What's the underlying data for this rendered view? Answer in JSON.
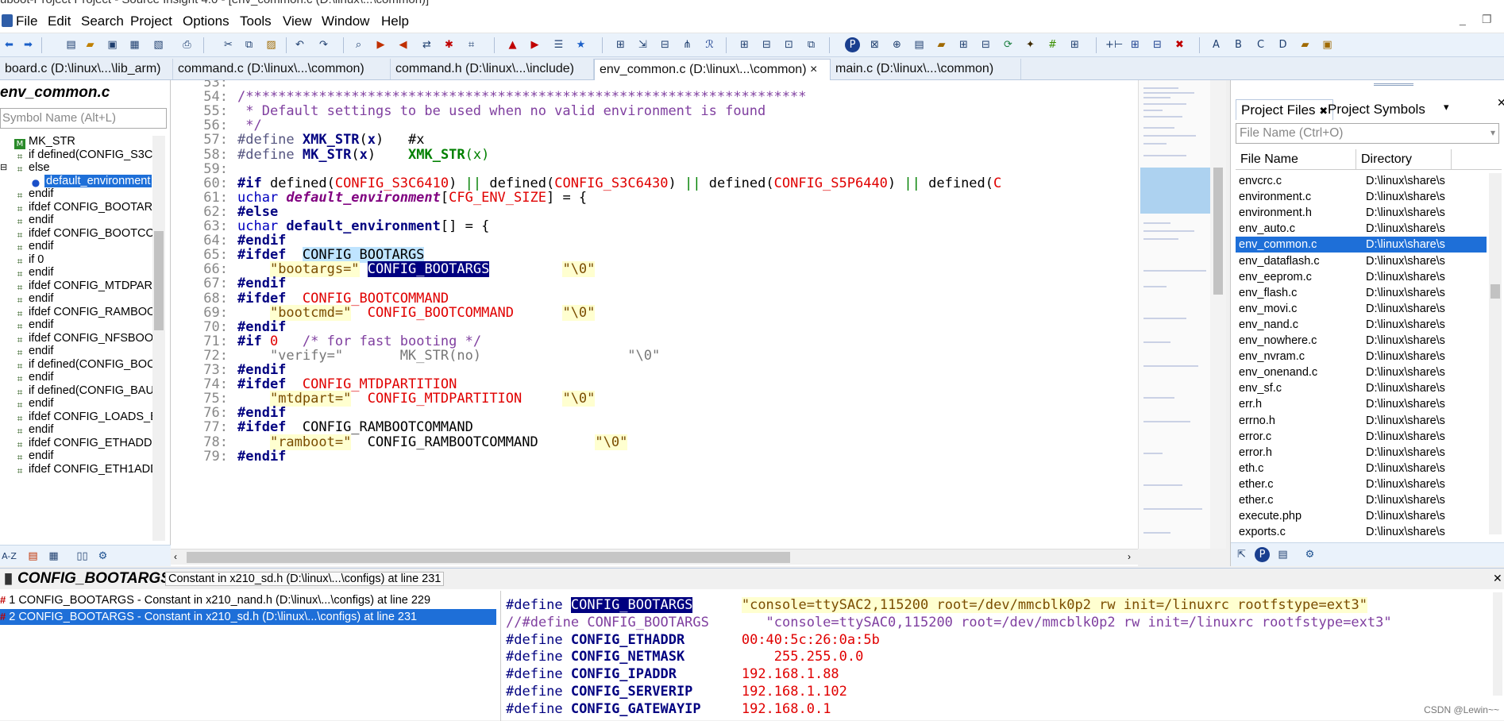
{
  "window": {
    "title": "uboot-Project Project - Source Insight 4.0 - [env_common.c (D:\\linux\\...\\common)]"
  },
  "menu": [
    "File",
    "Edit",
    "Search",
    "Project",
    "Options",
    "Tools",
    "View",
    "Window",
    "Help"
  ],
  "tabs": [
    {
      "label": "board.c (D:\\linux\\...\\lib_arm)"
    },
    {
      "label": "command.c (D:\\linux\\...\\common)"
    },
    {
      "label": "command.h (D:\\linux\\...\\include)"
    },
    {
      "label": "env_common.c (D:\\linux\\...\\common)",
      "close": "×"
    },
    {
      "label": "main.c (D:\\linux\\...\\common)"
    }
  ],
  "symbol_window": {
    "title": "env_common.c",
    "search_placeholder": "Symbol Name (Alt+L)",
    "items": [
      {
        "label": "MK_STR",
        "icon": "macro-icon"
      },
      {
        "label": "if defined(CONFIG_S3C6",
        "icon": "block-icon"
      },
      {
        "label": "else",
        "icon": "block-icon"
      },
      {
        "label": "default_environment",
        "icon": "variable-icon",
        "selected": true
      },
      {
        "label": "endif",
        "icon": "block-icon"
      },
      {
        "label": "ifdef CONFIG_BOOTARG",
        "icon": "block-icon"
      },
      {
        "label": "endif",
        "icon": "block-icon"
      },
      {
        "label": "ifdef CONFIG_BOOTCOM",
        "icon": "block-icon"
      },
      {
        "label": "endif",
        "icon": "block-icon"
      },
      {
        "label": "if 0",
        "icon": "block-icon"
      },
      {
        "label": "endif",
        "icon": "block-icon"
      },
      {
        "label": "ifdef CONFIG_MTDPART",
        "icon": "block-icon"
      },
      {
        "label": "endif",
        "icon": "block-icon"
      },
      {
        "label": "ifdef CONFIG_RAMBOO",
        "icon": "block-icon"
      },
      {
        "label": "endif",
        "icon": "block-icon"
      },
      {
        "label": "ifdef CONFIG_NFSBOOT",
        "icon": "block-icon"
      },
      {
        "label": "endif",
        "icon": "block-icon"
      },
      {
        "label": "if defined(CONFIG_BOC",
        "icon": "block-icon"
      },
      {
        "label": "endif",
        "icon": "block-icon"
      },
      {
        "label": "if defined(CONFIG_BAU",
        "icon": "block-icon"
      },
      {
        "label": "endif",
        "icon": "block-icon"
      },
      {
        "label": "ifdef CONFIG_LOADS_E",
        "icon": "block-icon"
      },
      {
        "label": "endif",
        "icon": "block-icon"
      },
      {
        "label": "ifdef CONFIG_ETHADDI",
        "icon": "block-icon"
      },
      {
        "label": "endif",
        "icon": "block-icon"
      },
      {
        "label": "ifdef CONFIG_ETH1ADD",
        "icon": "block-icon"
      }
    ]
  },
  "editor": {
    "lines": [
      {
        "n": "53:",
        "segs": []
      },
      {
        "n": "54:",
        "segs": [
          {
            "t": "/*********************************************************************",
            "c": "cmt"
          }
        ]
      },
      {
        "n": "55:",
        "segs": [
          {
            "t": " * Default settings to be used when no valid environment is found",
            "c": "cmt"
          }
        ]
      },
      {
        "n": "56:",
        "segs": [
          {
            "t": " */",
            "c": "cmt"
          }
        ]
      },
      {
        "n": "57:",
        "segs": [
          {
            "t": "#define ",
            "c": "pp"
          },
          {
            "t": "XMK_STR",
            "c": "mac"
          },
          {
            "t": "(",
            "c": ""
          },
          {
            "t": "x",
            "c": "mac"
          },
          {
            "t": ")   #x",
            "c": ""
          }
        ]
      },
      {
        "n": "58:",
        "segs": [
          {
            "t": "#define ",
            "c": "pp"
          },
          {
            "t": "MK_STR",
            "c": "mac"
          },
          {
            "t": "(",
            "c": ""
          },
          {
            "t": "x",
            "c": "mac"
          },
          {
            "t": ")    ",
            "c": ""
          },
          {
            "t": "XMK_STR",
            "c": "grnb"
          },
          {
            "t": "(",
            "c": "grn"
          },
          {
            "t": "x",
            "c": "grn"
          },
          {
            "t": ")",
            "c": "grn"
          }
        ]
      },
      {
        "n": "59:",
        "segs": []
      },
      {
        "n": "60:",
        "segs": [
          {
            "t": "#if ",
            "c": "kw"
          },
          {
            "t": "defined(",
            "c": ""
          },
          {
            "t": "CONFIG_S3C6410",
            "c": "red"
          },
          {
            "t": ") ",
            "c": ""
          },
          {
            "t": "||",
            "c": "grn"
          },
          {
            "t": " defined(",
            "c": ""
          },
          {
            "t": "CONFIG_S3C6430",
            "c": "red"
          },
          {
            "t": ") ",
            "c": ""
          },
          {
            "t": "||",
            "c": "grn"
          },
          {
            "t": " defined(",
            "c": ""
          },
          {
            "t": "CONFIG_S5P6440",
            "c": "red"
          },
          {
            "t": ") ",
            "c": ""
          },
          {
            "t": "||",
            "c": "grn"
          },
          {
            "t": " defined(",
            "c": ""
          },
          {
            "t": "C",
            "c": "red"
          }
        ]
      },
      {
        "n": "61:",
        "segs": [
          {
            "t": "uchar ",
            "c": "kws"
          },
          {
            "t": "default_environment",
            "c": "it"
          },
          {
            "t": "[",
            "c": ""
          },
          {
            "t": "CFG_ENV_SIZE",
            "c": "red"
          },
          {
            "t": "] = {",
            "c": ""
          }
        ]
      },
      {
        "n": "62:",
        "segs": [
          {
            "t": "#else",
            "c": "kw"
          }
        ]
      },
      {
        "n": "63:",
        "segs": [
          {
            "t": "uchar ",
            "c": "kws"
          },
          {
            "t": "default_environment",
            "c": "mac"
          },
          {
            "t": "[] = {",
            "c": ""
          }
        ]
      },
      {
        "n": "64:",
        "segs": [
          {
            "t": "#endif",
            "c": "kw"
          }
        ]
      },
      {
        "n": "65:",
        "segs": [
          {
            "t": "#ifdef  ",
            "c": "kw"
          },
          {
            "t": "CONFIG_BOOTARGS",
            "c": "hl1"
          }
        ]
      },
      {
        "n": "66:",
        "segs": [
          {
            "t": "    ",
            "c": ""
          },
          {
            "t": "\"bootargs=\"",
            "c": "str"
          },
          {
            "t": " ",
            "c": ""
          },
          {
            "t": "CONFIG_BOOTARGS",
            "c": "hl2"
          },
          {
            "t": "         ",
            "c": ""
          },
          {
            "t": "\"\\0\"",
            "c": "str"
          }
        ]
      },
      {
        "n": "67:",
        "segs": [
          {
            "t": "#endif",
            "c": "kw"
          }
        ]
      },
      {
        "n": "68:",
        "segs": [
          {
            "t": "#ifdef  ",
            "c": "kw"
          },
          {
            "t": "CONFIG_BOOTCOMMAND",
            "c": "red"
          }
        ]
      },
      {
        "n": "69:",
        "segs": [
          {
            "t": "    ",
            "c": ""
          },
          {
            "t": "\"bootcmd=\"",
            "c": "str"
          },
          {
            "t": "  ",
            "c": ""
          },
          {
            "t": "CONFIG_BOOTCOMMAND",
            "c": "red"
          },
          {
            "t": "      ",
            "c": ""
          },
          {
            "t": "\"\\0\"",
            "c": "str"
          }
        ]
      },
      {
        "n": "70:",
        "segs": [
          {
            "t": "#endif",
            "c": "kw"
          }
        ]
      },
      {
        "n": "71:",
        "segs": [
          {
            "t": "#if ",
            "c": "kw"
          },
          {
            "t": "0",
            "c": "red"
          },
          {
            "t": "   ",
            "c": ""
          },
          {
            "t": "/* for fast booting */",
            "c": "cmt"
          }
        ]
      },
      {
        "n": "72:",
        "segs": [
          {
            "t": "    \"verify=\"       MK_STR(no)                  \"\\0\"",
            "c": "gray"
          }
        ]
      },
      {
        "n": "73:",
        "segs": [
          {
            "t": "#endif",
            "c": "kw"
          }
        ]
      },
      {
        "n": "74:",
        "segs": [
          {
            "t": "#ifdef  ",
            "c": "kw"
          },
          {
            "t": "CONFIG_MTDPARTITION",
            "c": "red"
          }
        ]
      },
      {
        "n": "75:",
        "segs": [
          {
            "t": "    ",
            "c": ""
          },
          {
            "t": "\"mtdpart=\"",
            "c": "str"
          },
          {
            "t": "  ",
            "c": ""
          },
          {
            "t": "CONFIG_MTDPARTITION",
            "c": "red"
          },
          {
            "t": "     ",
            "c": ""
          },
          {
            "t": "\"\\0\"",
            "c": "str"
          }
        ]
      },
      {
        "n": "76:",
        "segs": [
          {
            "t": "#endif",
            "c": "kw"
          }
        ]
      },
      {
        "n": "77:",
        "segs": [
          {
            "t": "#ifdef  ",
            "c": "kw"
          },
          {
            "t": "CONFIG_RAMBOOTCOMMAND",
            "c": ""
          }
        ]
      },
      {
        "n": "78:",
        "segs": [
          {
            "t": "    ",
            "c": ""
          },
          {
            "t": "\"ramboot=\"",
            "c": "str"
          },
          {
            "t": "  CONFIG_RAMBOOTCOMMAND       ",
            "c": ""
          },
          {
            "t": "\"\\0\"",
            "c": "str"
          }
        ]
      },
      {
        "n": "79:",
        "segs": [
          {
            "t": "#endif",
            "c": "kw"
          }
        ]
      }
    ]
  },
  "project_window": {
    "tabs": [
      "Project Files",
      "Project Symbols"
    ],
    "search_placeholder": "File Name (Ctrl+O)",
    "col_name": "File Name",
    "col_dir": "Directory",
    "files": [
      {
        "name": "envcrc.c",
        "dir": "D:\\linux\\share\\s"
      },
      {
        "name": "environment.c",
        "dir": "D:\\linux\\share\\s"
      },
      {
        "name": "environment.h",
        "dir": "D:\\linux\\share\\s"
      },
      {
        "name": "env_auto.c",
        "dir": "D:\\linux\\share\\s"
      },
      {
        "name": "env_common.c",
        "dir": "D:\\linux\\share\\s",
        "selected": true
      },
      {
        "name": "env_dataflash.c",
        "dir": "D:\\linux\\share\\s"
      },
      {
        "name": "env_eeprom.c",
        "dir": "D:\\linux\\share\\s"
      },
      {
        "name": "env_flash.c",
        "dir": "D:\\linux\\share\\s"
      },
      {
        "name": "env_movi.c",
        "dir": "D:\\linux\\share\\s"
      },
      {
        "name": "env_nand.c",
        "dir": "D:\\linux\\share\\s"
      },
      {
        "name": "env_nowhere.c",
        "dir": "D:\\linux\\share\\s"
      },
      {
        "name": "env_nvram.c",
        "dir": "D:\\linux\\share\\s"
      },
      {
        "name": "env_onenand.c",
        "dir": "D:\\linux\\share\\s"
      },
      {
        "name": "env_sf.c",
        "dir": "D:\\linux\\share\\s"
      },
      {
        "name": "err.h",
        "dir": "D:\\linux\\share\\s"
      },
      {
        "name": "errno.h",
        "dir": "D:\\linux\\share\\s"
      },
      {
        "name": "error.c",
        "dir": "D:\\linux\\share\\s"
      },
      {
        "name": "error.h",
        "dir": "D:\\linux\\share\\s"
      },
      {
        "name": "eth.c",
        "dir": "D:\\linux\\share\\s"
      },
      {
        "name": "ether.c",
        "dir": "D:\\linux\\share\\s"
      },
      {
        "name": "ether.c",
        "dir": "D:\\linux\\share\\s"
      },
      {
        "name": "execute.php",
        "dir": "D:\\linux\\share\\s"
      },
      {
        "name": "exports.c",
        "dir": "D:\\linux\\share\\s"
      }
    ]
  },
  "context_window": {
    "symbol": "CONFIG_BOOTARGS",
    "description": "Constant in x210_sd.h (D:\\linux\\...\\configs) at line 231",
    "refs": [
      {
        "label": "1 CONFIG_BOOTARGS - Constant in x210_nand.h (D:\\linux\\...\\configs) at line 229"
      },
      {
        "label": "2 CONFIG_BOOTARGS - Constant in x210_sd.h (D:\\linux\\...\\configs) at line 231",
        "selected": true
      }
    ],
    "code": [
      {
        "segs": [
          {
            "t": "#define ",
            "c": "dk"
          },
          {
            "t": "CONFIG_BOOTARGS",
            "c": "hl2"
          },
          {
            "t": "      ",
            "c": ""
          },
          {
            "t": "\"console=ttySAC2,115200 root=/dev/mmcblk0p2 rw init=/linuxrc rootfstype=ext3\"",
            "c": "str"
          }
        ]
      },
      {
        "segs": [
          {
            "t": "//#define CONFIG_BOOTARGS       \"console=ttySAC0,115200 root=/dev/mmcblk0p2 rw init=/linuxrc rootfstype=ext3\"",
            "c": "cmt2"
          }
        ]
      },
      {
        "segs": [
          {
            "t": "#define ",
            "c": "dk"
          },
          {
            "t": "CONFIG_ETHADDR",
            "c": "mac"
          },
          {
            "t": "       ",
            "c": ""
          },
          {
            "t": "00:40:5c:26:0a:5b",
            "c": "red"
          }
        ]
      },
      {
        "segs": [
          {
            "t": "#define ",
            "c": "dk"
          },
          {
            "t": "CONFIG_NETMASK",
            "c": "mac"
          },
          {
            "t": "           ",
            "c": ""
          },
          {
            "t": "255.255.0.0",
            "c": "red"
          }
        ]
      },
      {
        "segs": [
          {
            "t": "#define ",
            "c": "dk"
          },
          {
            "t": "CONFIG_IPADDR",
            "c": "mac"
          },
          {
            "t": "        ",
            "c": ""
          },
          {
            "t": "192.168.1.88",
            "c": "red"
          }
        ]
      },
      {
        "segs": [
          {
            "t": "#define ",
            "c": "dk"
          },
          {
            "t": "CONFIG_SERVERIP",
            "c": "mac"
          },
          {
            "t": "      ",
            "c": ""
          },
          {
            "t": "192.168.1.102",
            "c": "red"
          }
        ]
      },
      {
        "segs": [
          {
            "t": "#define ",
            "c": "dk"
          },
          {
            "t": "CONFIG_GATEWAYIP",
            "c": "mac"
          },
          {
            "t": "     ",
            "c": ""
          },
          {
            "t": "192.168.0.1",
            "c": "red"
          }
        ]
      }
    ]
  },
  "watermark": "CSDN @Lewin~~",
  "colors": {
    "selection": "#1e6fd8",
    "toolbar_bg": "#eaf2fb",
    "keyword": "#000080",
    "macro_value": "#e00000"
  }
}
